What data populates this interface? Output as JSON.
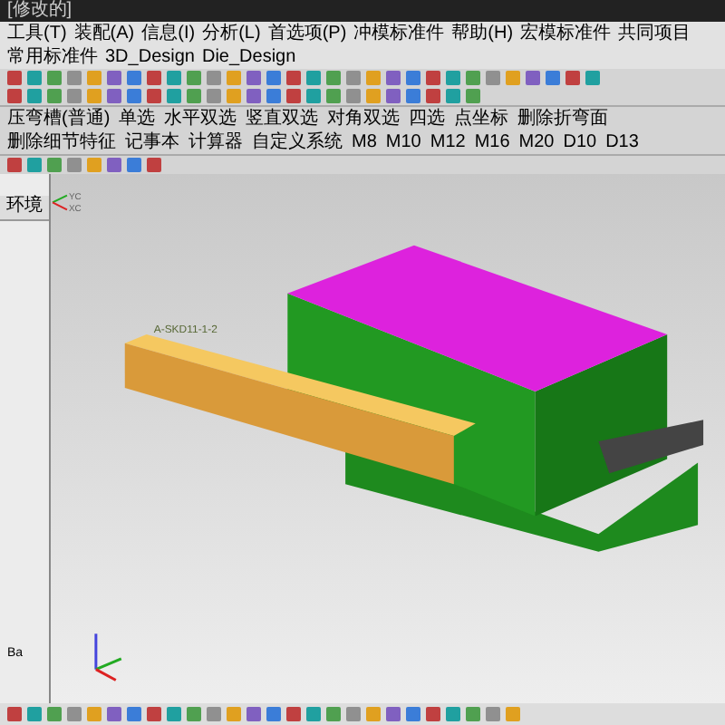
{
  "window": {
    "title": "[修改的]"
  },
  "menu": [
    "工具(T)",
    "装配(A)",
    "信息(I)",
    "分析(L)",
    "首选项(P)",
    "冲模标准件",
    "帮助(H)",
    "宏模标准件",
    "共同项目",
    "常用标准件",
    "3D_Design",
    "Die_Design"
  ],
  "command_bar": [
    "压弯槽(普通)",
    "单选",
    "水平双选",
    "竖直双选",
    "对角双选",
    "四选",
    "点坐标",
    "删除折弯面",
    "删除细节特征",
    "记事本",
    "计算器",
    "自定义系统",
    "M8",
    "M10",
    "M12",
    "M16",
    "M20",
    "D10",
    "D13"
  ],
  "navigator": {
    "header": "环境",
    "value": "Ba"
  },
  "viewport": {
    "part_label": "A-SKD11-1-2",
    "axis_labels": [
      "YC",
      "XC"
    ]
  }
}
